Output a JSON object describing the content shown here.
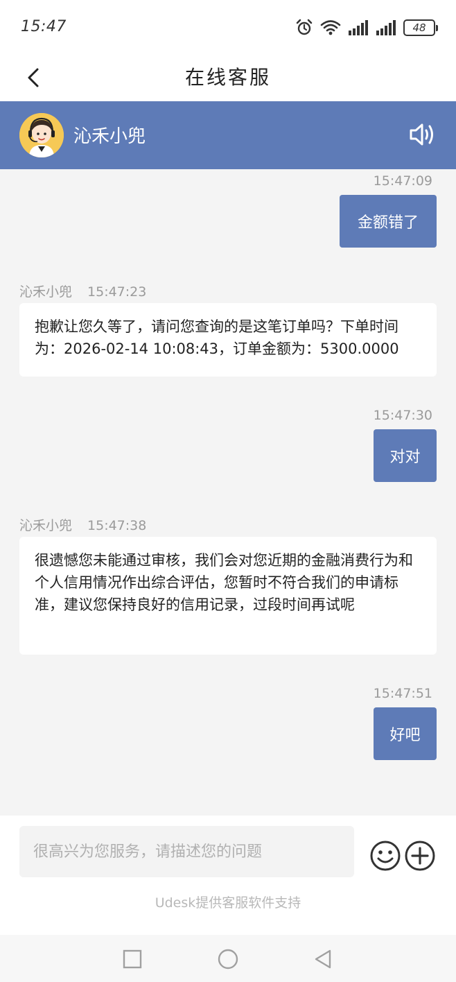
{
  "status_bar": {
    "time": "15:47",
    "battery": "48",
    "icons": [
      "alarm-icon",
      "wifi-icon",
      "signal-icon",
      "signal-icon",
      "battery-icon"
    ]
  },
  "nav": {
    "title": "在线客服",
    "back_icon": "chevron-left-icon"
  },
  "agent": {
    "name": "沁禾小兜",
    "avatar_icon": "agent-avatar-icon",
    "sound_icon": "speaker-icon"
  },
  "messages": [
    {
      "side": "out",
      "time": "15:47:09",
      "text": "金额错了"
    },
    {
      "side": "in",
      "sender": "沁禾小兜",
      "time": "15:47:23",
      "text": "抱歉让您久等了，请问您查询的是这笔订单吗？下单时间为：2026-02-14 10:08:43，订单金额为：5300.0000"
    },
    {
      "side": "out",
      "time": "15:47:30",
      "text": "对对"
    },
    {
      "side": "in",
      "sender": "沁禾小兜",
      "time": "15:47:38",
      "text": "很遗憾您未能通过审核，我们会对您近期的金融消费行为和个人信用情况作出综合评估，您暂时不符合我们的申请标准，建议您保持良好的信用记录，过段时间再试呢"
    },
    {
      "side": "out",
      "time": "15:47:51",
      "text": "好吧"
    }
  ],
  "input": {
    "placeholder": "很高兴为您服务，请描述您的问题",
    "value": ""
  },
  "powered_by": "Udesk提供客服软件支持",
  "colors": {
    "accent": "#5e7bb7",
    "background": "#f4f4f4",
    "meta_text": "#9a9a9a"
  }
}
